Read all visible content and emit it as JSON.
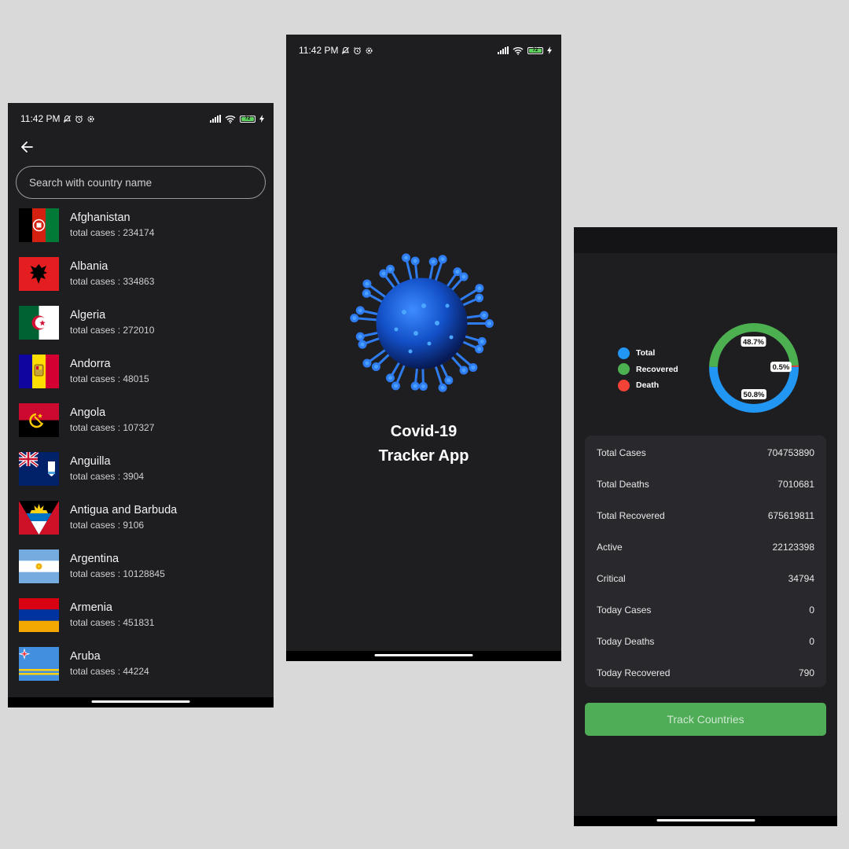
{
  "status": {
    "time": "11:42 PM",
    "battery": "72"
  },
  "list_screen": {
    "search_placeholder": "Search with country name",
    "countries": [
      {
        "name": "Afghanistan",
        "cases": "total cases : 234174",
        "flag": "afghanistan"
      },
      {
        "name": "Albania",
        "cases": "total cases : 334863",
        "flag": "albania"
      },
      {
        "name": "Algeria",
        "cases": "total cases : 272010",
        "flag": "algeria"
      },
      {
        "name": "Andorra",
        "cases": "total cases : 48015",
        "flag": "andorra"
      },
      {
        "name": "Angola",
        "cases": "total cases : 107327",
        "flag": "angola"
      },
      {
        "name": "Anguilla",
        "cases": "total cases : 3904",
        "flag": "anguilla"
      },
      {
        "name": "Antigua and Barbuda",
        "cases": "total cases : 9106",
        "flag": "antigua"
      },
      {
        "name": "Argentina",
        "cases": "total cases : 10128845",
        "flag": "argentina"
      },
      {
        "name": "Armenia",
        "cases": "total cases : 451831",
        "flag": "armenia"
      },
      {
        "name": "Aruba",
        "cases": "total cases : 44224",
        "flag": "aruba"
      }
    ]
  },
  "splash_screen": {
    "title_line1": "Covid-19",
    "title_line2": "Tracker App"
  },
  "stats_screen": {
    "legend": [
      {
        "label": "Total",
        "color": "#2196f3"
      },
      {
        "label": "Recovered",
        "color": "#4caf50"
      },
      {
        "label": "Death",
        "color": "#f44336"
      }
    ],
    "chart": {
      "type": "pie",
      "slices": [
        {
          "label": "Total",
          "value": 50.8,
          "text": "50.8%",
          "color": "#2196f3"
        },
        {
          "label": "Recovered",
          "value": 48.7,
          "text": "48.7%",
          "color": "#4caf50"
        },
        {
          "label": "Death",
          "value": 0.5,
          "text": "0.5%",
          "color": "#f44336"
        }
      ]
    },
    "stats": [
      {
        "label": "Total Cases",
        "value": "704753890"
      },
      {
        "label": "Total Deaths",
        "value": "7010681"
      },
      {
        "label": "Total Recovered",
        "value": "675619811"
      },
      {
        "label": "Active",
        "value": "22123398"
      },
      {
        "label": "Critical",
        "value": "34794"
      },
      {
        "label": "Today Cases",
        "value": "0"
      },
      {
        "label": "Today Deaths",
        "value": "0"
      },
      {
        "label": "Today Recovered",
        "value": "790"
      }
    ],
    "button_label": "Track Countries"
  }
}
